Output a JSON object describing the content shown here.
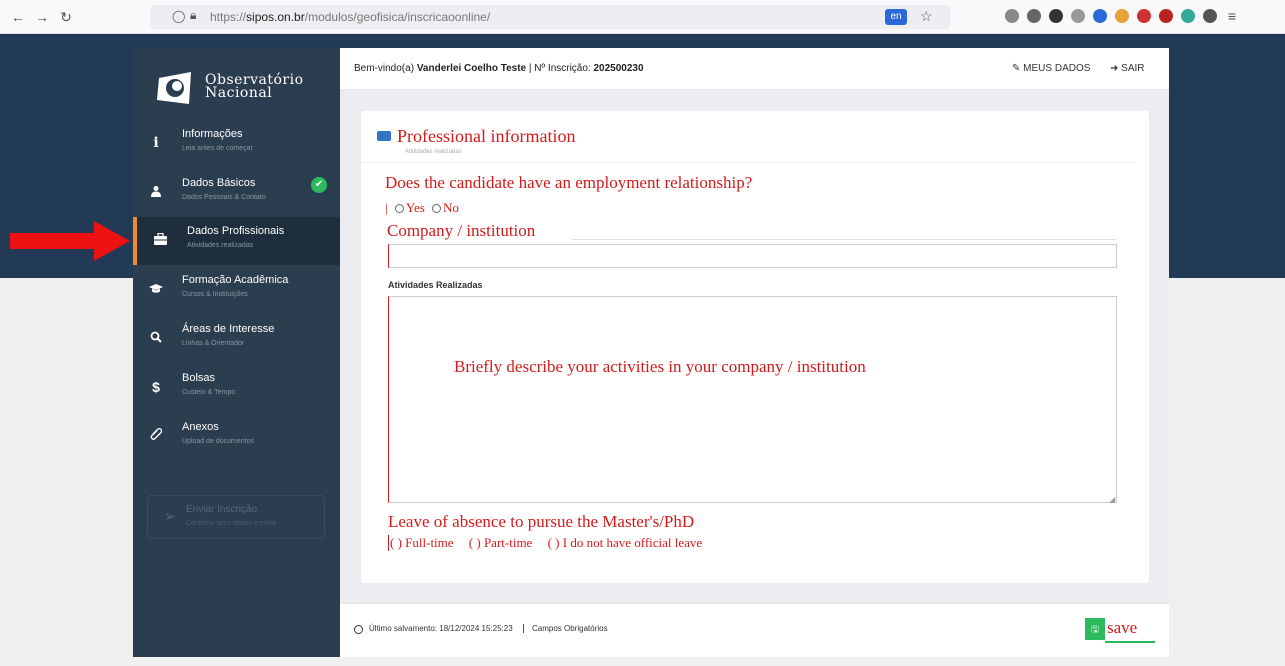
{
  "browser": {
    "url_domain": "sipos.on.br",
    "url_prefix": "https://",
    "url_path": "/modulos/geofisica/inscricaoonline/",
    "translate_badge": "en"
  },
  "logo": {
    "line1": "Observatório",
    "line2": "Nacional"
  },
  "sidebar": {
    "items": [
      {
        "label": "Informações",
        "sub": "Leia antes de começar",
        "icon": "i"
      },
      {
        "label": "Dados Básicos",
        "sub": "Dados Pessoais & Contato",
        "icon": "user",
        "completed": true
      },
      {
        "label": "Dados Profissionais",
        "sub": "Atividades realizadas",
        "icon": "briefcase",
        "active": true
      },
      {
        "label": "Formação Acadêmica",
        "sub": "Cursos & Instituições",
        "icon": "graduation-cap"
      },
      {
        "label": "Áreas de Interesse",
        "sub": "Linhas & Orientador",
        "icon": "search"
      },
      {
        "label": "Bolsas",
        "sub": "Custeio & Tempo",
        "icon": "$"
      },
      {
        "label": "Anexos",
        "sub": "Upload de documentos",
        "icon": "paperclip"
      }
    ],
    "submit": {
      "label": "Enviar Inscrição",
      "sub": "Confirme seus dados e envie"
    }
  },
  "topbar": {
    "welcome_prefix": "Bem-vindo(a) ",
    "user_name": "Vanderlei Coelho Teste",
    "reg_prefix": " | Nº Inscrição: ",
    "reg_number": "202500230",
    "my_data": "MEUS DADOS",
    "logout": "SAIR"
  },
  "form": {
    "title": "Professional information",
    "ghost_subtitle": "Atividades realizadas",
    "employment_question": "Does the candidate have an employment relationship?",
    "yes": "Yes",
    "no": "No",
    "company_label": "Company / institution",
    "company_value": "",
    "activities_label": "Atividades Realizadas",
    "activities_hint": "Briefly describe your activities in your company / institution",
    "leave_label": "Leave of absence to pursue the Master's/PhD",
    "leave_options": [
      "( ) Full-time",
      "( ) Part-time",
      "( ) I do not have official leave"
    ]
  },
  "footer": {
    "last_saved": "Último salvamento: 18/12/2024 15:25:23",
    "required": "Campos Obrigatórios",
    "save": "save"
  },
  "colors": {
    "sidebar": "#2b3e50",
    "band": "#223a55",
    "accent": "#f08b29",
    "annotation": "#d51a1a",
    "success": "#2cba5e"
  }
}
